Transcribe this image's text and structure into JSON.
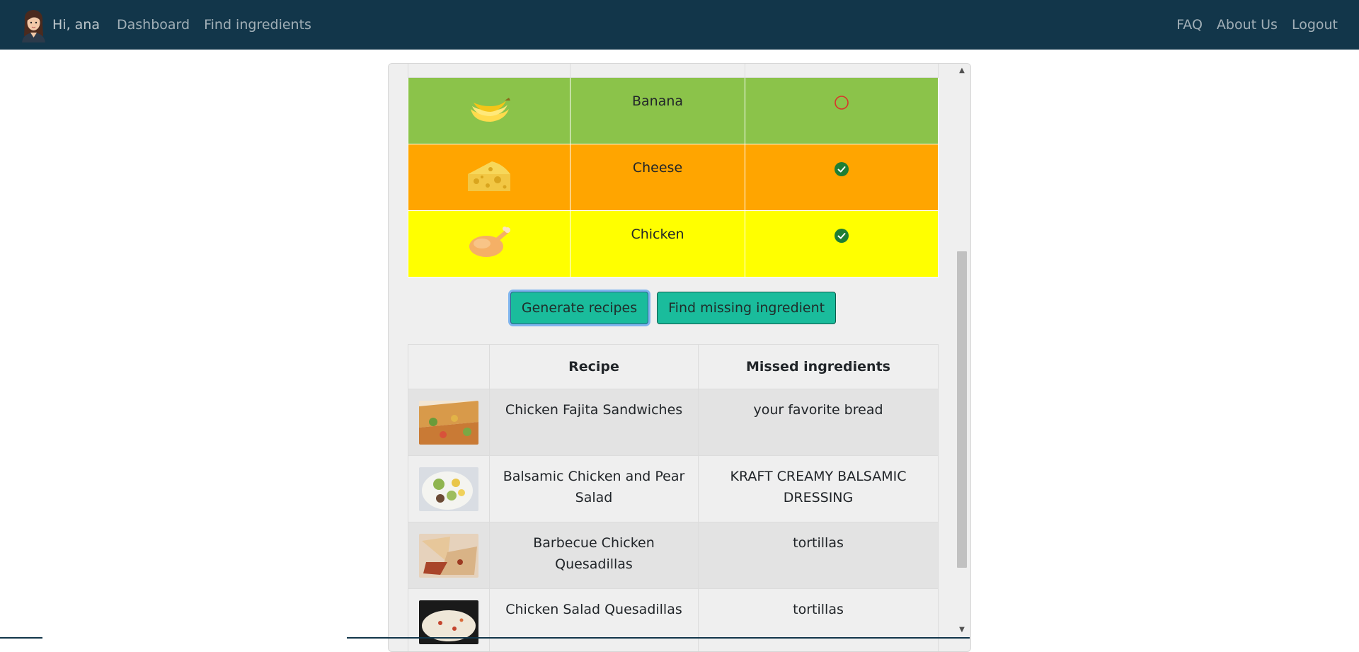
{
  "nav": {
    "greeting": "Hi, ana",
    "links": [
      "Dashboard",
      "Find ingredients"
    ],
    "right_links": [
      "FAQ",
      "About Us",
      "Logout"
    ],
    "background": "#12364a"
  },
  "ingredients": [
    {
      "name": "Banana",
      "icon": "banana-icon",
      "status": "missing",
      "row_color": "#8bc34a"
    },
    {
      "name": "Cheese",
      "icon": "cheese-icon",
      "status": "available",
      "row_color": "#ffa500"
    },
    {
      "name": "Chicken",
      "icon": "chicken-icon",
      "status": "available",
      "row_color": "#ffff00"
    }
  ],
  "buttons": {
    "generate": "Generate recipes",
    "find_missing": "Find missing ingredient",
    "color": "#1abc9c"
  },
  "recipes_table": {
    "headers": [
      "",
      "Recipe",
      "Missed ingredients"
    ],
    "rows": [
      {
        "recipe": "Chicken Fajita Sandwiches",
        "missed": "your favorite bread"
      },
      {
        "recipe": "Balsamic Chicken and Pear Salad",
        "missed": "KRAFT CREAMY BALSAMIC DRESSING"
      },
      {
        "recipe": "Barbecue Chicken Quesadillas",
        "missed": "tortillas"
      },
      {
        "recipe": "Chicken Salad Quesadillas",
        "missed": "tortillas"
      }
    ]
  }
}
